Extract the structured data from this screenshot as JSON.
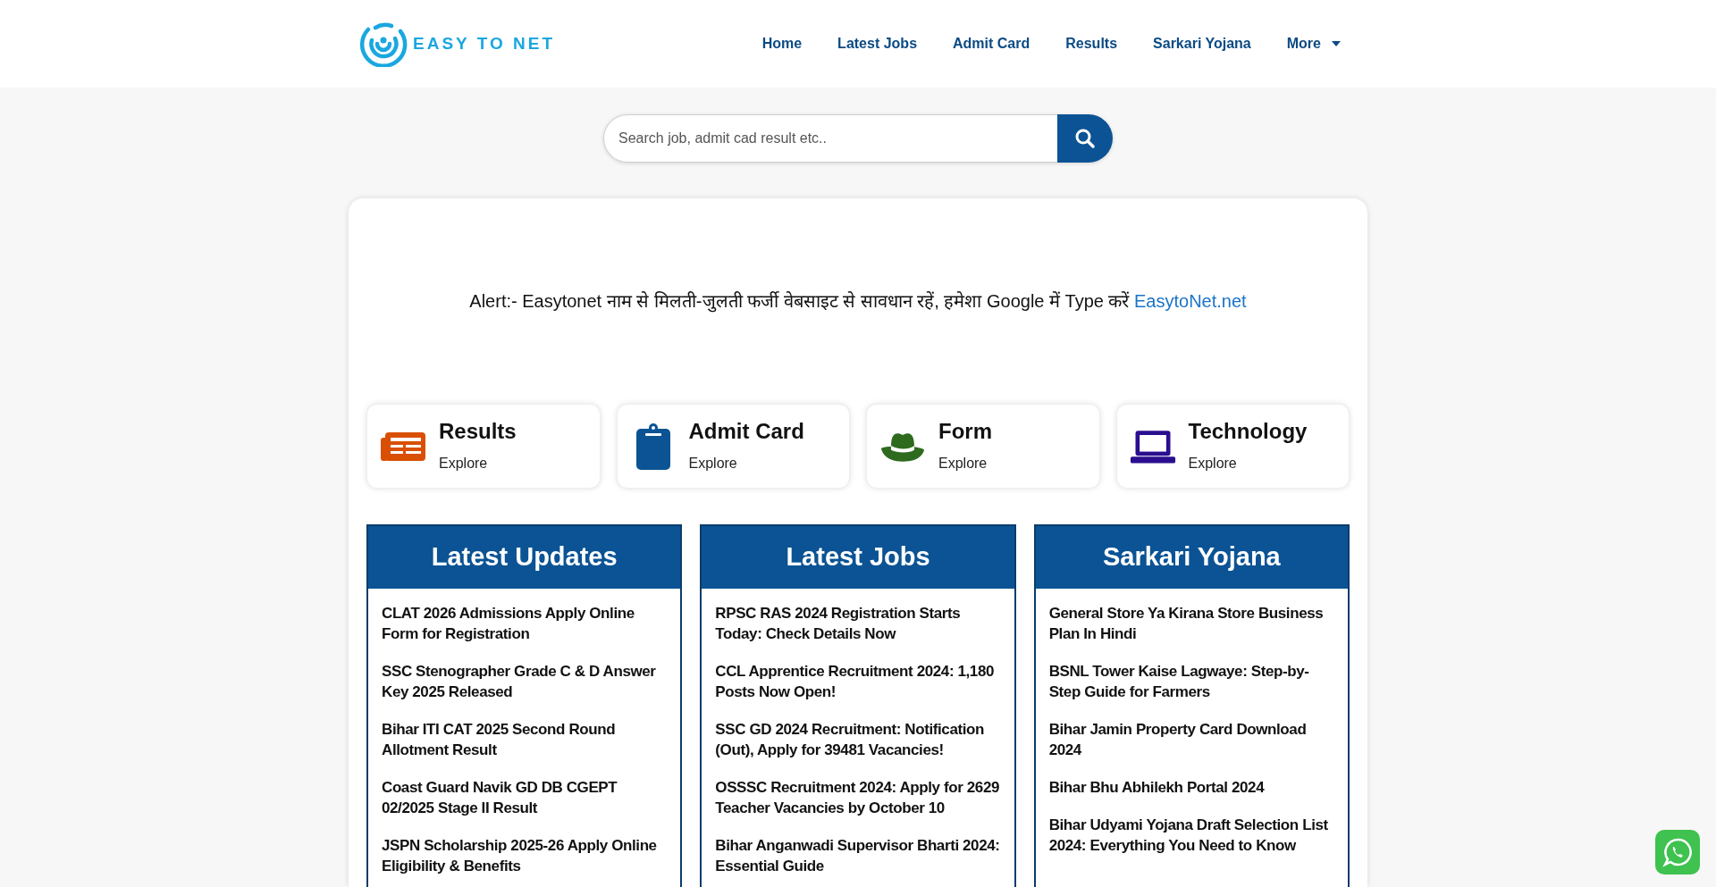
{
  "logo": {
    "text": "EASY TO NET"
  },
  "nav": [
    {
      "label": "Home",
      "has_caret": false
    },
    {
      "label": "Latest Jobs",
      "has_caret": false
    },
    {
      "label": "Admit Card",
      "has_caret": false
    },
    {
      "label": "Results",
      "has_caret": false
    },
    {
      "label": "Sarkari Yojana",
      "has_caret": false
    },
    {
      "label": "More",
      "has_caret": true
    }
  ],
  "search": {
    "placeholder": "Search job, admit cad result etc.."
  },
  "alert": {
    "text": "Alert:- Easytonet नाम से मिलती-जुलती फर्जी वेबसाइट से सावधान रहें, हमेशा Google में Type करें",
    "link": "EasytoNet.net"
  },
  "categories": [
    {
      "kind": "newspaper",
      "title": "Results",
      "subtitle": "Explore",
      "color": "#d94f04"
    },
    {
      "kind": "clipboard",
      "title": "Admit Card",
      "subtitle": "Explore",
      "color": "#0b5394"
    },
    {
      "kind": "hat",
      "title": "Form",
      "subtitle": "Explore",
      "color": "#2e6b1f"
    },
    {
      "kind": "laptop",
      "title": "Technology",
      "subtitle": "Explore",
      "color": "#2b0e8f"
    }
  ],
  "columns": [
    {
      "title": "Latest Updates",
      "items": [
        "CLAT 2026 Admissions Apply Online Form for Registration",
        "SSC Stenographer Grade C & D Answer Key 2025 Released",
        "Bihar ITI CAT 2025 Second Round Allotment Result",
        "Coast Guard Navik GD DB CGEPT 02/2025 Stage II Result",
        "JSPN Scholarship 2025-26 Apply Online Eligibility & Benefits"
      ]
    },
    {
      "title": "Latest Jobs",
      "items": [
        "RPSC RAS 2024 Registration Starts Today: Check Details Now",
        "CCL Apprentice Recruitment 2024: 1,180 Posts Now Open!",
        "SSC GD 2024 Recruitment: Notification (Out), Apply for 39481 Vacancies!",
        "OSSSC Recruitment 2024: Apply for 2629 Teacher Vacancies by October 10",
        "Bihar Anganwadi Supervisor Bharti 2024: Essential Guide"
      ]
    },
    {
      "title": "Sarkari Yojana",
      "items": [
        "General Store Ya Kirana Store Business Plan In Hindi",
        "BSNL Tower Kaise Lagwaye: Step-by-Step Guide for Farmers",
        "Bihar Jamin Property Card Download 2024",
        "Bihar Bhu Abhilekh Portal 2024",
        "Bihar Udyami Yojana Draft Selection List 2024: Everything You Need to Know"
      ]
    }
  ]
}
